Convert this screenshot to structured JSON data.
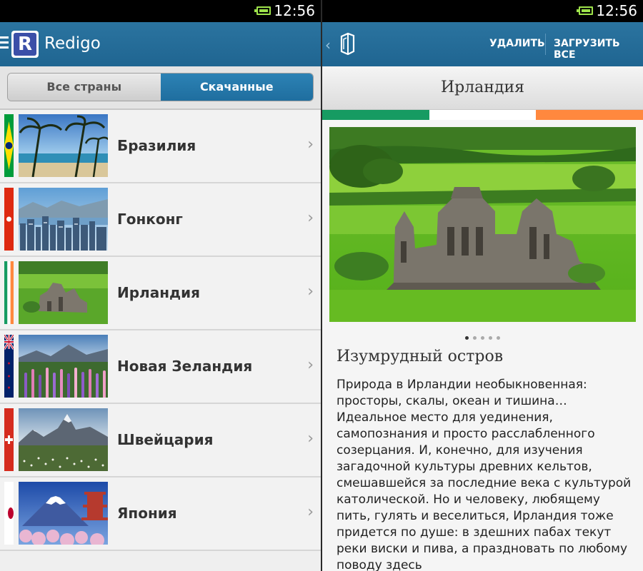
{
  "status": {
    "time": "12:56"
  },
  "left": {
    "app_title": "Redigo",
    "logo_letter": "R",
    "tabs": [
      {
        "label": "Все страны",
        "active": false
      },
      {
        "label": "Скачанные",
        "active": true
      }
    ],
    "countries": [
      {
        "name": "Бразилия",
        "flag": [
          "#009c3b",
          "#ffdf00",
          "#002776"
        ]
      },
      {
        "name": "Гонконг",
        "flag": [
          "#de2910",
          "#de2910",
          "#de2910"
        ]
      },
      {
        "name": "Ирландия",
        "flag": [
          "#169b62",
          "#ffffff",
          "#ff883e"
        ]
      },
      {
        "name": "Новая Зеландия",
        "flag": [
          "#012169",
          "#c8102e",
          "#012169"
        ]
      },
      {
        "name": "Швейцария",
        "flag": [
          "#d52b1e",
          "#d52b1e",
          "#d52b1e"
        ]
      },
      {
        "name": "Япония",
        "flag": [
          "#ffffff",
          "#bc002d",
          "#ffffff"
        ]
      }
    ],
    "chevron": "›"
  },
  "right": {
    "back": "‹",
    "actions": {
      "delete": "УДАЛИТЬ",
      "download_all": "ЗАГРУЗИТЬ ВСЕ"
    },
    "country_title": "Ирландия",
    "flag_colors": [
      "#169b62",
      "#ffffff",
      "#ff883e"
    ],
    "slide_count": 5,
    "active_slide": 0,
    "section_title": "Изумрудный остров",
    "description": "Природа в Ирландии необыкновенная: просторы, скалы, океан и тишина… Идеальное место для уединения, самопознания и просто расслабленного созерцания. И, конечно, для изучения загадочной культуры древних кельтов, смешавшейся за последние века с культурой католической. Но и человеку, любящему пить, гулять и веселиться, Ирландия тоже придется по душе: в здешних пабах текут реки виски и пива, а праздновать по любому поводу здесь"
  },
  "colors": {
    "appbar": "#236b96",
    "accent": "#2478aa"
  }
}
